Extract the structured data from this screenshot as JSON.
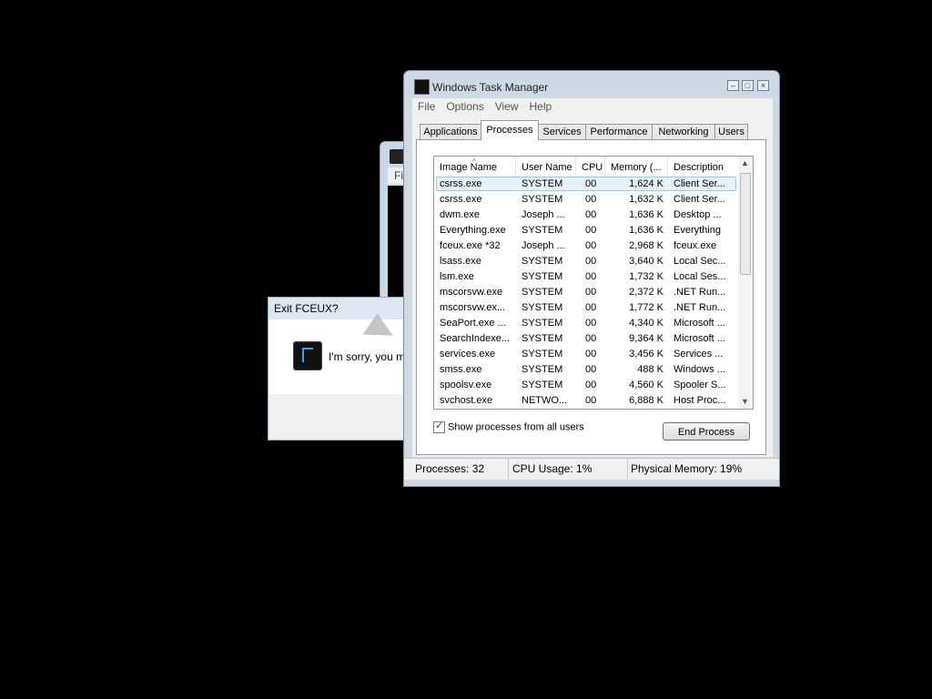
{
  "fceux_main": {
    "menu_fragment": "Fil"
  },
  "exit_dialog": {
    "title": "Exit FCEUX?",
    "message": "I'm sorry, you m"
  },
  "task_manager": {
    "title": "Windows Task Manager",
    "menu": [
      "File",
      "Options",
      "View",
      "Help"
    ],
    "tabs": [
      {
        "label": "Applications",
        "active": false
      },
      {
        "label": "Processes",
        "active": true
      },
      {
        "label": "Services",
        "active": false
      },
      {
        "label": "Performance",
        "active": false
      },
      {
        "label": "Networking",
        "active": false
      },
      {
        "label": "Users",
        "active": false
      }
    ],
    "columns": [
      "Image Name",
      "User Name",
      "CPU",
      "Memory (...",
      "Description"
    ],
    "sort_indicator": "^",
    "rows": [
      {
        "name": "csrss.exe",
        "user": "SYSTEM",
        "cpu": "00",
        "memory": "1,624 K",
        "description": "Client Ser...",
        "selected": true
      },
      {
        "name": "csrss.exe",
        "user": "SYSTEM",
        "cpu": "00",
        "memory": "1,632 K",
        "description": "Client Ser..."
      },
      {
        "name": "dwm.exe",
        "user": "Joseph ...",
        "cpu": "00",
        "memory": "1,636 K",
        "description": "Desktop ..."
      },
      {
        "name": "Everything.exe",
        "user": "SYSTEM",
        "cpu": "00",
        "memory": "1,636 K",
        "description": "Everything"
      },
      {
        "name": "fceux.exe *32",
        "user": "Joseph ...",
        "cpu": "00",
        "memory": "2,968 K",
        "description": "fceux.exe"
      },
      {
        "name": "lsass.exe",
        "user": "SYSTEM",
        "cpu": "00",
        "memory": "3,640 K",
        "description": "Local Sec..."
      },
      {
        "name": "lsm.exe",
        "user": "SYSTEM",
        "cpu": "00",
        "memory": "1,732 K",
        "description": "Local Ses..."
      },
      {
        "name": "mscorsvw.exe",
        "user": "SYSTEM",
        "cpu": "00",
        "memory": "2,372 K",
        "description": ".NET Run..."
      },
      {
        "name": "mscorsvw.ex...",
        "user": "SYSTEM",
        "cpu": "00",
        "memory": "1,772 K",
        "description": ".NET Run..."
      },
      {
        "name": "SeaPort.exe ...",
        "user": "SYSTEM",
        "cpu": "00",
        "memory": "4,340 K",
        "description": "Microsoft ..."
      },
      {
        "name": "SearchIndexe...",
        "user": "SYSTEM",
        "cpu": "00",
        "memory": "9,364 K",
        "description": "Microsoft ..."
      },
      {
        "name": "services.exe",
        "user": "SYSTEM",
        "cpu": "00",
        "memory": "3,456 K",
        "description": "Services ..."
      },
      {
        "name": "smss.exe",
        "user": "SYSTEM",
        "cpu": "00",
        "memory": "488 K",
        "description": "Windows ..."
      },
      {
        "name": "spoolsv.exe",
        "user": "SYSTEM",
        "cpu": "00",
        "memory": "4,560 K",
        "description": "Spooler S..."
      },
      {
        "name": "svchost.exe",
        "user": "NETWO...",
        "cpu": "00",
        "memory": "6,888 K",
        "description": "Host Proc..."
      }
    ],
    "show_all_label": "Show processes from all users",
    "show_all_checked": true,
    "end_process_label": "End Process",
    "status": {
      "processes": "Processes: 32",
      "cpu": "CPU Usage: 1%",
      "memory": "Physical Memory: 19%"
    }
  }
}
